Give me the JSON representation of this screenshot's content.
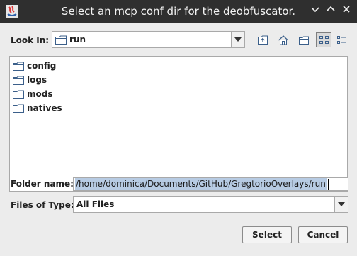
{
  "window": {
    "title": "Select an mcp conf dir for the deobfuscator."
  },
  "look_in": {
    "label": "Look In:",
    "value": "run"
  },
  "toolbar": {
    "up_icon": "folder-up-icon",
    "home_icon": "home-icon",
    "new_folder_icon": "new-folder-icon",
    "list_view_icon": "list-view-icon",
    "details_view_icon": "details-view-icon"
  },
  "files": [
    {
      "name": "config"
    },
    {
      "name": "logs"
    },
    {
      "name": "mods"
    },
    {
      "name": "natives"
    }
  ],
  "folder_name": {
    "label": "Folder name:",
    "value": "/home/dominica/Documents/GitHub/GregtorioOverlays/run"
  },
  "files_of_type": {
    "label": "Files of Type:",
    "value": "All Files"
  },
  "buttons": {
    "select": "Select",
    "cancel": "Cancel"
  },
  "colors": {
    "titlebar": "#2f2f2f",
    "selection": "#b7cbe3",
    "folder_outline": "#3b5f8a"
  }
}
